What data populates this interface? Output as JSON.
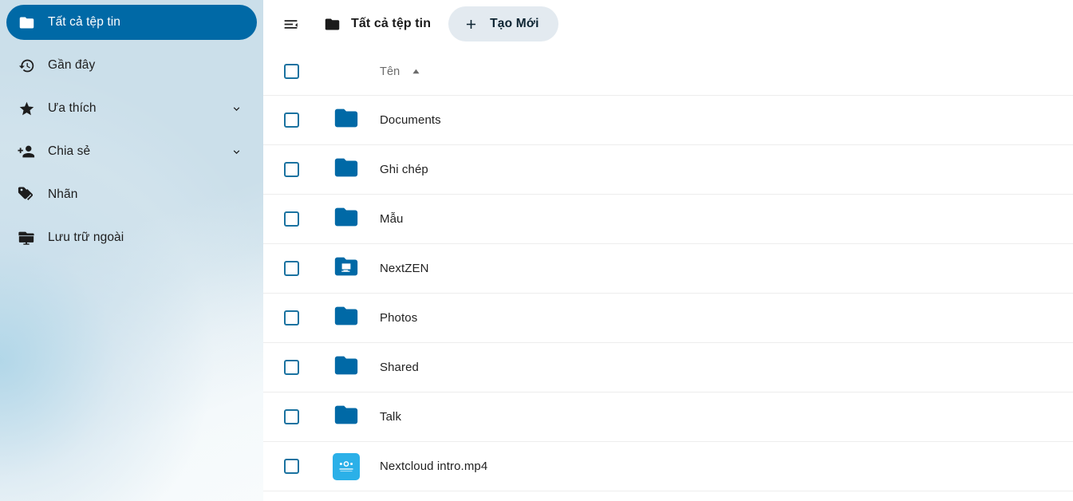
{
  "sidebar": {
    "items": [
      {
        "label": "Tất cả tệp tin",
        "icon": "folder-icon",
        "name": "sidebar-item-all-files",
        "active": true,
        "chevron": false
      },
      {
        "label": "Gần đây",
        "icon": "history-icon",
        "name": "sidebar-item-recent",
        "active": false,
        "chevron": false
      },
      {
        "label": "Ưa thích",
        "icon": "star-icon",
        "name": "sidebar-item-favorites",
        "active": false,
        "chevron": true
      },
      {
        "label": "Chia sẻ",
        "icon": "account-plus-icon",
        "name": "sidebar-item-shares",
        "active": false,
        "chevron": true
      },
      {
        "label": "Nhãn",
        "icon": "tag-multiple-icon",
        "name": "sidebar-item-tags",
        "active": false,
        "chevron": false
      },
      {
        "label": "Lưu trữ ngoài",
        "icon": "external-storage-icon",
        "name": "sidebar-item-external-storage",
        "active": false,
        "chevron": false
      }
    ]
  },
  "topbar": {
    "menu_toggle_icon": "menu-open-icon",
    "breadcrumb_icon": "folder-icon",
    "breadcrumb_label": "Tất cả tệp tin",
    "new_button_label": "Tạo Mới",
    "new_button_icon": "plus-icon"
  },
  "table": {
    "select_all_checkbox": "select-all-checkbox",
    "columns": [
      {
        "label": "Tên",
        "sort": "ascending"
      }
    ],
    "rows": [
      {
        "name": "Documents",
        "icon": "folder-icon",
        "type": "folder"
      },
      {
        "name": "Ghi chép",
        "icon": "folder-icon",
        "type": "folder"
      },
      {
        "name": "Mẫu",
        "icon": "folder-icon",
        "type": "folder"
      },
      {
        "name": "NextZEN",
        "icon": "folder-external-icon",
        "type": "folder-external"
      },
      {
        "name": "Photos",
        "icon": "folder-icon",
        "type": "folder"
      },
      {
        "name": "Shared",
        "icon": "folder-icon",
        "type": "folder"
      },
      {
        "name": "Talk",
        "icon": "folder-icon",
        "type": "folder"
      },
      {
        "name": "Nextcloud intro.mp4",
        "icon": "video-thumbnail-icon",
        "type": "file"
      }
    ]
  },
  "colors": {
    "accent": "#0069a6",
    "sidebar_bg": "#cbdfea",
    "folder_blue": "#0069a6",
    "button_bg": "#e3eaf0",
    "thumb_bg": "#2bb0e8",
    "row_border": "#ededed",
    "text": "#222222"
  }
}
